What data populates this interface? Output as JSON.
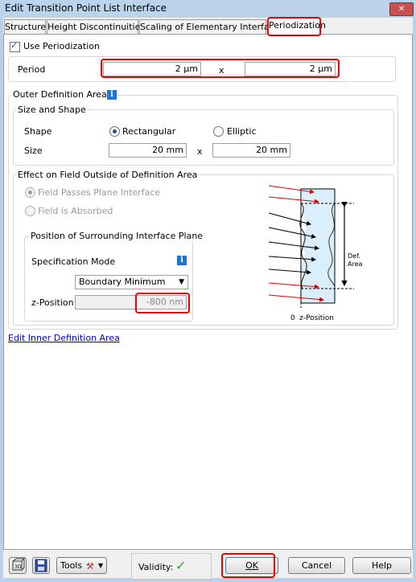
{
  "window": {
    "title": "Edit Transition Point List Interface",
    "close_glyph": "✕"
  },
  "tabs": [
    {
      "label": "Structure"
    },
    {
      "label": "Height Discontinuities"
    },
    {
      "label": "Scaling of Elementary Interface"
    },
    {
      "label": "Periodization"
    }
  ],
  "periodization": {
    "use_label": "Use Periodization",
    "use_checked": true,
    "period_label": "Period",
    "period_x": "2 µm",
    "period_sep": "x",
    "period_y": "2 µm"
  },
  "outer": {
    "title": "Outer Definition Area",
    "info_glyph": "i",
    "size_shape": {
      "title": "Size and Shape",
      "shape_label": "Shape",
      "rect_label": "Rectangular",
      "elliptic_label": "Elliptic",
      "selected": "Rectangular",
      "size_label": "Size",
      "size_x": "20 mm",
      "size_sep": "x",
      "size_y": "20 mm"
    },
    "effect": {
      "title": "Effect on Field Outside of Definition Area",
      "opt_passes": "Field Passes Plane Interface",
      "opt_absorbed": "Field is Absorbed",
      "selected": "Field Passes Plane Interface",
      "position": {
        "title": "Position of Surrounding Interface Plane",
        "spec_label": "Specification Mode",
        "info_glyph": "i",
        "mode_value": "Boundary Minimum",
        "z_label": "z-Position",
        "z_value": "-800 nm"
      }
    },
    "diagram": {
      "def_area": "Def.\nArea",
      "def_label_1": "Def.",
      "def_label_2": "Area",
      "zero": "0",
      "zpos": "z-Position"
    }
  },
  "inner_link": "Edit Inner Definition Area",
  "footer": {
    "tools_label": "Tools",
    "validity_label": "Validity:",
    "validity_mark": "✓",
    "ok": "OK",
    "cancel": "Cancel",
    "help": "Help"
  },
  "colors": {
    "accent_red": "#e00000",
    "info_blue": "#1c75d6",
    "link": "#0000cc",
    "valid_green": "#2fa62f"
  }
}
